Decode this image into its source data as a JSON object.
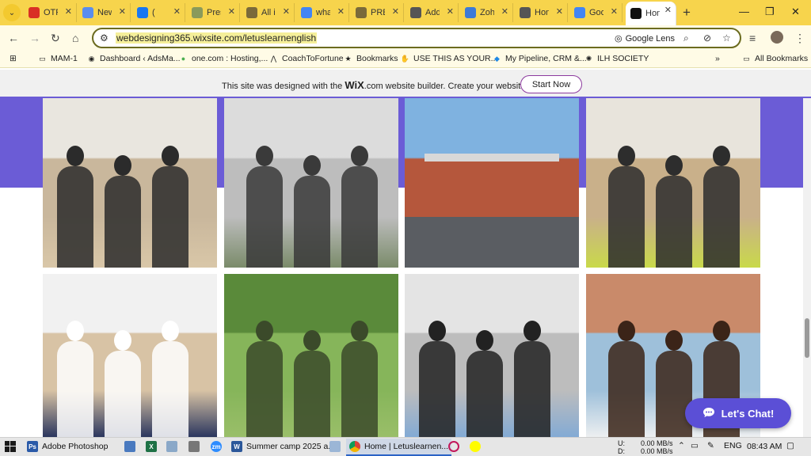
{
  "browser": {
    "tabs": [
      {
        "title": "OTP",
        "icon": "gmail-icon",
        "color": "#d93025"
      },
      {
        "title": "New",
        "icon": "pen-icon",
        "color": "#5a8dee"
      },
      {
        "title": "( ",
        "icon": "facebook-icon",
        "color": "#1877f2"
      },
      {
        "title": "Pres",
        "icon": "leaf-icon",
        "color": "#8a9a5b"
      },
      {
        "title": "All i",
        "icon": "seal-icon",
        "color": "#7a6a3a"
      },
      {
        "title": "wha",
        "icon": "google-icon",
        "color": "#4285f4"
      },
      {
        "title": "PRE",
        "icon": "seal-icon",
        "color": "#7a6a3a"
      },
      {
        "title": "Add",
        "icon": "globe-icon",
        "color": "#555555"
      },
      {
        "title": "Zoh",
        "icon": "zoho-icon",
        "color": "#3d7ad6"
      },
      {
        "title": "Hon",
        "icon": "globe-icon",
        "color": "#555555"
      },
      {
        "title": "Goo",
        "icon": "google-translate-icon",
        "color": "#4285f4"
      },
      {
        "title": "Hon",
        "icon": "wix-icon",
        "color": "#111111",
        "active": true
      }
    ],
    "url": "webdesigning365.wixsite.com/letuslearnenglish",
    "lens_label": "Google Lens",
    "bookmarks": [
      {
        "label": "MAM-1",
        "icon": "folder-icon"
      },
      {
        "label": "Dashboard ‹ AdsMa...",
        "icon": "globe-icon"
      },
      {
        "label": "one.com : Hosting,...",
        "icon": "green-dot-icon"
      },
      {
        "label": "CoachToFortune",
        "icon": "coach-icon"
      },
      {
        "label": "Bookmarks",
        "icon": "star-icon"
      },
      {
        "label": "USE THIS AS YOUR...",
        "icon": "hand-icon"
      },
      {
        "label": "My Pipeline, CRM &...",
        "icon": "pipeline-icon"
      },
      {
        "label": "ILH SOCIETY",
        "icon": "ilh-icon"
      }
    ],
    "all_bookmarks": "All Bookmarks"
  },
  "wix_banner": {
    "text_before": "This site was designed with the ",
    "brand": "WiX",
    "brand_suffix": ".com",
    "text_after": " website builder. Create your website today.",
    "button": "Start Now"
  },
  "colors": {
    "accent": "#6b5cd6",
    "chat": "#5b4fd6",
    "tabstrip": "#f7d44c"
  },
  "gallery": [
    {
      "name": "photo-students-temperature-check"
    },
    {
      "name": "photo-students-on-stairs"
    },
    {
      "name": "photo-school-building"
    },
    {
      "name": "photo-workshop-students"
    },
    {
      "name": "photo-volleyball-team"
    },
    {
      "name": "photo-students-outdoor-park"
    },
    {
      "name": "photo-computer-lab"
    },
    {
      "name": "photo-smiling-student"
    }
  ],
  "chat_button": "Let's Chat!",
  "taskbar": {
    "items": [
      {
        "label": "Adobe Photoshop",
        "icon": "photoshop-icon"
      },
      {
        "label": "Summer camp 2025 a...",
        "icon": "word-icon"
      },
      {
        "label": "Home | Letuslearnen...",
        "icon": "chrome-icon",
        "active": true
      }
    ],
    "net_up": "0.00 MB/s",
    "net_down": "0.00 MB/s",
    "net_up_label": "U:",
    "net_down_label": "D:",
    "lang": "ENG",
    "time": "08:43 AM"
  }
}
